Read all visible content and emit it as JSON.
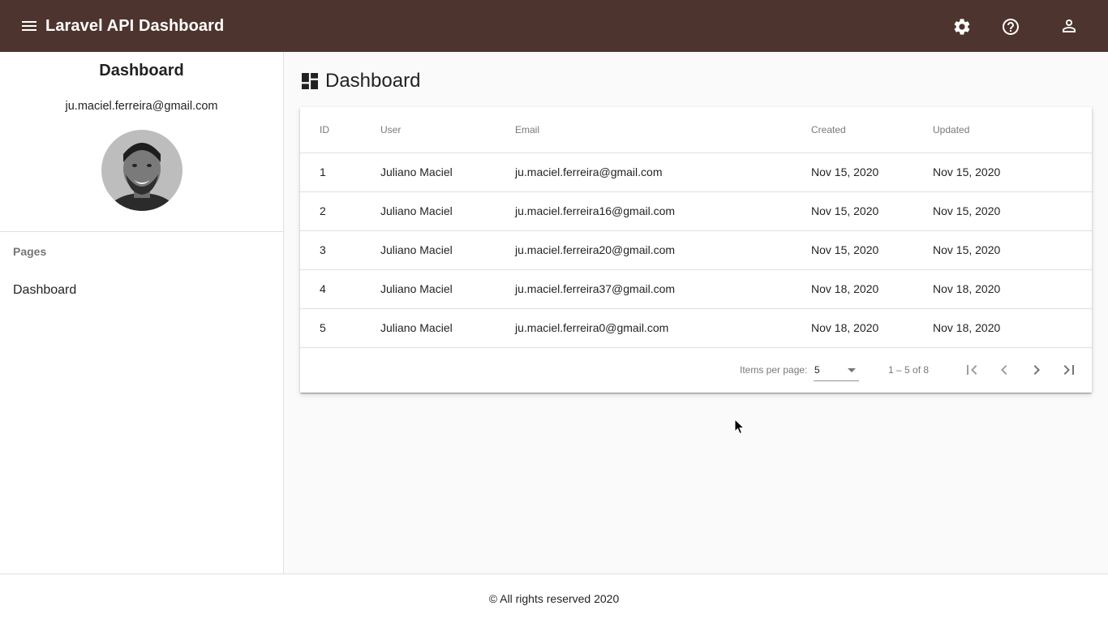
{
  "app": {
    "title": "Laravel API Dashboard",
    "bar_color": "#4e342e"
  },
  "topbar": {
    "menu_icon": "menu-icon",
    "icons": [
      "settings-icon",
      "help-icon",
      "account-icon"
    ]
  },
  "sidebar": {
    "title": "Dashboard",
    "email": "ju.maciel.ferreira@gmail.com",
    "avatar_icon": "user-avatar",
    "subheader": "Pages",
    "items": [
      {
        "label": "Dashboard"
      }
    ]
  },
  "main": {
    "heading": "Dashboard",
    "heading_icon": "dashboard-icon",
    "table": {
      "columns": [
        "ID",
        "User",
        "Email",
        "Created",
        "Updated"
      ],
      "rows": [
        [
          "1",
          "Juliano Maciel",
          "ju.maciel.ferreira@gmail.com",
          "Nov 15, 2020",
          "Nov 15, 2020"
        ],
        [
          "2",
          "Juliano Maciel",
          "ju.maciel.ferreira16@gmail.com",
          "Nov 15, 2020",
          "Nov 15, 2020"
        ],
        [
          "3",
          "Juliano Maciel",
          "ju.maciel.ferreira20@gmail.com",
          "Nov 15, 2020",
          "Nov 15, 2020"
        ],
        [
          "4",
          "Juliano Maciel",
          "ju.maciel.ferreira37@gmail.com",
          "Nov 18, 2020",
          "Nov 18, 2020"
        ],
        [
          "5",
          "Juliano Maciel",
          "ju.maciel.ferreira0@gmail.com",
          "Nov 18, 2020",
          "Nov 18, 2020"
        ]
      ]
    },
    "paginator": {
      "items_per_page_label": "Items per page:",
      "items_per_page_value": "5",
      "range_label": "1 – 5 of 8"
    }
  },
  "footer": {
    "text": "© All rights reserved 2020"
  }
}
